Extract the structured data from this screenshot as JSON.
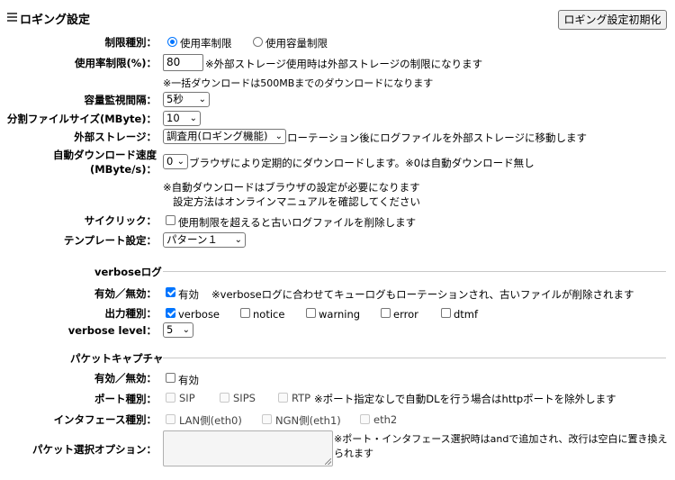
{
  "header": {
    "title": "ロギング設定",
    "reset_button": "ロギング設定初期化"
  },
  "limit_type": {
    "label": "制限種別：",
    "option_rate": "使用率制限",
    "option_capacity": "使用容量制限",
    "selected": "rate"
  },
  "usage_rate": {
    "label": "使用率制限(%)：",
    "value": "80",
    "note1": "※外部ストレージ使用時は外部ストレージの制限になります",
    "note2": "※一括ダウンロードは500MBまでのダウンロードになります"
  },
  "capacity_interval": {
    "label": "容量監視間隔：",
    "value": "5秒"
  },
  "split_size": {
    "label": "分割ファイルサイズ(MByte)：",
    "value": "10"
  },
  "external_storage": {
    "label": "外部ストレージ：",
    "value": "調査用(ロギング機能)",
    "note": "ローテーション後にログファイルを外部ストレージに移動します"
  },
  "auto_download": {
    "label1": "自動ダウンロード速度",
    "label2": "(MByte/s)：",
    "value": "0",
    "note": "ブラウザにより定期的にダウンロードします。※0は自動ダウンロード無し",
    "note2": "※自動ダウンロードはブラウザの設定が必要になります",
    "note3": "設定方法はオンラインマニュアルを確認してください"
  },
  "cyclic": {
    "label": "サイクリック：",
    "option": "使用制限を超えると古いログファイルを削除します",
    "checked": false
  },
  "template": {
    "label": "テンプレート設定：",
    "value": "パターン１"
  },
  "verbose_section": {
    "title": "verboseログ",
    "enable_label": "有効／無効：",
    "enable_option": "有効",
    "enabled": true,
    "enable_note": "※verboseログに合わせてキューログもローテーションされ、古いファイルが削除されます",
    "output_label": "出力種別：",
    "outputs": [
      {
        "name": "verbose",
        "checked": true
      },
      {
        "name": "notice",
        "checked": false
      },
      {
        "name": "warning",
        "checked": false
      },
      {
        "name": "error",
        "checked": false
      },
      {
        "name": "dtmf",
        "checked": false
      }
    ],
    "level_label": "verbose level：",
    "level_value": "5"
  },
  "packet_section": {
    "title": "パケットキャプチャ",
    "enable_label": "有効／無効：",
    "enable_option": "有効",
    "enabled": false,
    "port_label": "ポート種別：",
    "ports": [
      "SIP",
      "SIPS",
      "RTP"
    ],
    "port_note": "※ポート指定なしで自動DLを行う場合はhttpポートを除外します",
    "iface_label": "インタフェース種別：",
    "ifaces": [
      "LAN側(eth0)",
      "NGN側(eth1)",
      "eth2"
    ],
    "filter_label": "パケット選択オプション：",
    "filter_note1": "※ポート・インタフェース選択時はandで追加され、改行は空白に置き換え",
    "filter_note2": "られます",
    "filter_value": ""
  }
}
